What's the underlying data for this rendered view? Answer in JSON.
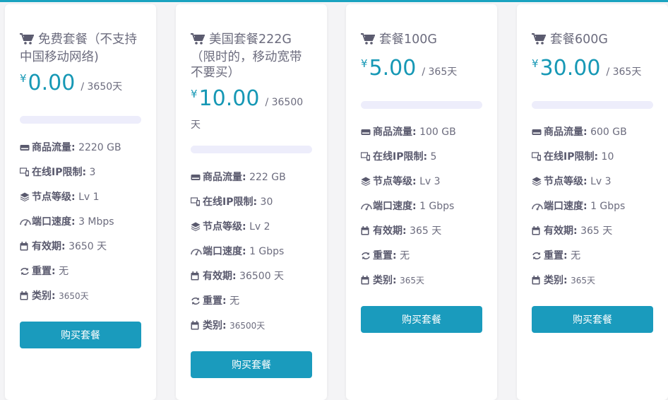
{
  "currency_symbol": "¥",
  "buy_label": "购买套餐",
  "colors": {
    "accent": "#1698b5",
    "button": "#1a9bbd",
    "bar": "#ededfb"
  },
  "cards": [
    {
      "title": "免费套餐（不支持中国移动网络)",
      "price": "0.00",
      "period": "/ 3650天",
      "features": [
        {
          "icon": "hdd-icon",
          "label": "商品流量:",
          "value": "2220 GB"
        },
        {
          "icon": "devices-icon",
          "label": "在线IP限制:",
          "value": "3"
        },
        {
          "icon": "layers-icon",
          "label": "节点等级:",
          "value": "Lv 1"
        },
        {
          "icon": "speedometer-icon",
          "label": "端口速度:",
          "value": "3 Mbps"
        },
        {
          "icon": "calendar-icon",
          "label": "有效期:",
          "value": "3650 天"
        },
        {
          "icon": "reset-icon",
          "label": "重置:",
          "value": "无"
        },
        {
          "icon": "calendar-icon",
          "label": "类别:",
          "value": "3650天"
        }
      ]
    },
    {
      "title": "美国套餐222G（限时的，移动宽带不要买）",
      "price": "10.00",
      "period": "/ 36500",
      "period2": "天",
      "features": [
        {
          "icon": "hdd-icon",
          "label": "商品流量:",
          "value": "222 GB"
        },
        {
          "icon": "devices-icon",
          "label": "在线IP限制:",
          "value": "30"
        },
        {
          "icon": "layers-icon",
          "label": "节点等级:",
          "value": "Lv 2"
        },
        {
          "icon": "speedometer-icon",
          "label": "端口速度:",
          "value": "1 Gbps"
        },
        {
          "icon": "calendar-icon",
          "label": "有效期:",
          "value": "36500 天"
        },
        {
          "icon": "reset-icon",
          "label": "重置:",
          "value": "无"
        },
        {
          "icon": "calendar-icon",
          "label": "类别:",
          "value": "36500天"
        }
      ]
    },
    {
      "title": "套餐100G",
      "price": "5.00",
      "period": "/ 365天",
      "features": [
        {
          "icon": "hdd-icon",
          "label": "商品流量:",
          "value": "100 GB"
        },
        {
          "icon": "devices-icon",
          "label": "在线IP限制:",
          "value": "5"
        },
        {
          "icon": "layers-icon",
          "label": "节点等级:",
          "value": "Lv 3"
        },
        {
          "icon": "speedometer-icon",
          "label": "端口速度:",
          "value": "1 Gbps"
        },
        {
          "icon": "calendar-icon",
          "label": "有效期:",
          "value": "365 天"
        },
        {
          "icon": "reset-icon",
          "label": "重置:",
          "value": "无"
        },
        {
          "icon": "calendar-icon",
          "label": "类别:",
          "value": "365天"
        }
      ]
    },
    {
      "title": "套餐600G",
      "price": "30.00",
      "period": "/ 365天",
      "features": [
        {
          "icon": "hdd-icon",
          "label": "商品流量:",
          "value": "600 GB"
        },
        {
          "icon": "devices-icon",
          "label": "在线IP限制:",
          "value": "10"
        },
        {
          "icon": "layers-icon",
          "label": "节点等级:",
          "value": "Lv 3"
        },
        {
          "icon": "speedometer-icon",
          "label": "端口速度:",
          "value": "1 Gbps"
        },
        {
          "icon": "calendar-icon",
          "label": "有效期:",
          "value": "365 天"
        },
        {
          "icon": "reset-icon",
          "label": "重置:",
          "value": "无"
        },
        {
          "icon": "calendar-icon",
          "label": "类别:",
          "value": "365天"
        }
      ]
    }
  ]
}
